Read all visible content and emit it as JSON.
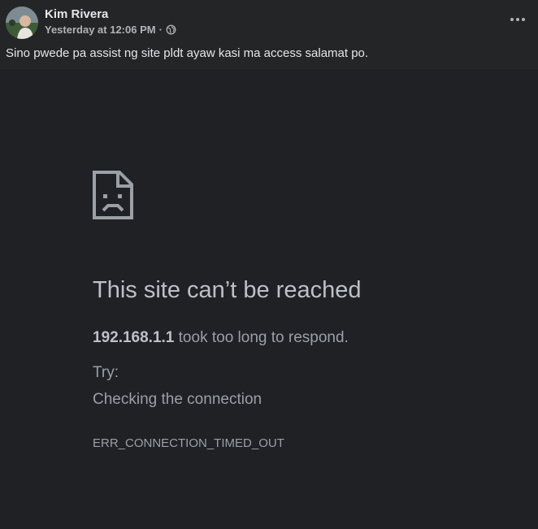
{
  "post": {
    "author": "Kim Rivera",
    "timestamp": "Yesterday at 12:06 PM",
    "separator": "·",
    "audience_icon": "globe-icon",
    "menu_icon": "more-options-icon",
    "text": "Sino pwede pa assist ng site pldt ayaw kasi ma access salamat po."
  },
  "error_page": {
    "icon": "sad-file-icon",
    "title": "This site can’t be reached",
    "host": "192.168.1.1",
    "detail_suffix": " took too long to respond.",
    "try_label": "Try:",
    "try_items": [
      "Checking the connection"
    ],
    "code": "ERR_CONNECTION_TIMED_OUT"
  },
  "colors": {
    "post_bg": "#242526",
    "error_bg": "#202124",
    "error_title": "#bdc1c6",
    "error_text": "#9aa0a6",
    "secondary_text": "#b0b3b8"
  }
}
